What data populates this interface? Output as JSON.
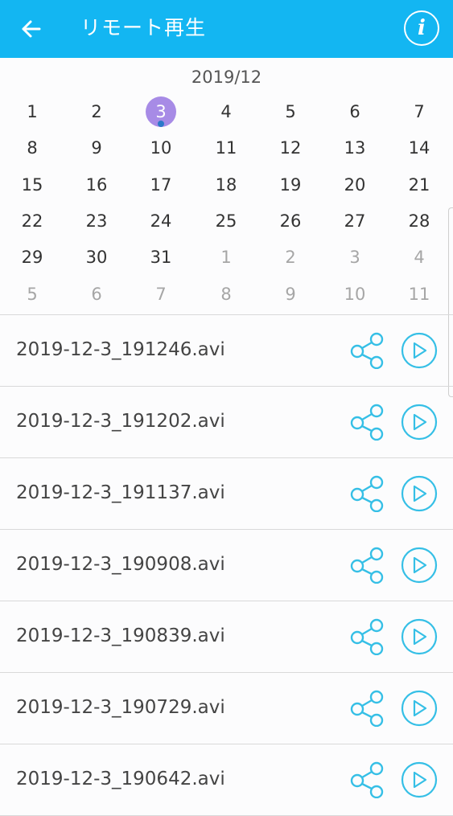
{
  "header": {
    "title": "リモート再生",
    "back_icon": "arrow-left-icon",
    "info_icon": "info-icon",
    "color": "#13b6f2"
  },
  "calendar": {
    "month_label": "2019/12",
    "selected_day": "3",
    "selected_color": "#a78be6",
    "weeks": [
      [
        {
          "d": "1",
          "c": true
        },
        {
          "d": "2",
          "c": true
        },
        {
          "d": "3",
          "c": true,
          "sel": true
        },
        {
          "d": "4",
          "c": true
        },
        {
          "d": "5",
          "c": true
        },
        {
          "d": "6",
          "c": true
        },
        {
          "d": "7",
          "c": true
        }
      ],
      [
        {
          "d": "8",
          "c": true
        },
        {
          "d": "9",
          "c": true
        },
        {
          "d": "10",
          "c": true
        },
        {
          "d": "11",
          "c": true
        },
        {
          "d": "12",
          "c": true
        },
        {
          "d": "13",
          "c": true
        },
        {
          "d": "14",
          "c": true
        }
      ],
      [
        {
          "d": "15",
          "c": true
        },
        {
          "d": "16",
          "c": true
        },
        {
          "d": "17",
          "c": true
        },
        {
          "d": "18",
          "c": true
        },
        {
          "d": "19",
          "c": true
        },
        {
          "d": "20",
          "c": true
        },
        {
          "d": "21",
          "c": true
        }
      ],
      [
        {
          "d": "22",
          "c": true
        },
        {
          "d": "23",
          "c": true
        },
        {
          "d": "24",
          "c": true
        },
        {
          "d": "25",
          "c": true
        },
        {
          "d": "26",
          "c": true
        },
        {
          "d": "27",
          "c": true
        },
        {
          "d": "28",
          "c": true
        }
      ],
      [
        {
          "d": "29",
          "c": true
        },
        {
          "d": "30",
          "c": true
        },
        {
          "d": "31",
          "c": true
        },
        {
          "d": "1",
          "c": false
        },
        {
          "d": "2",
          "c": false
        },
        {
          "d": "3",
          "c": false
        },
        {
          "d": "4",
          "c": false
        }
      ],
      [
        {
          "d": "5",
          "c": false
        },
        {
          "d": "6",
          "c": false
        },
        {
          "d": "7",
          "c": false
        },
        {
          "d": "8",
          "c": false
        },
        {
          "d": "9",
          "c": false
        },
        {
          "d": "10",
          "c": false
        },
        {
          "d": "11",
          "c": false
        }
      ]
    ]
  },
  "files": [
    {
      "name": "2019-12-3_191246.avi"
    },
    {
      "name": "2019-12-3_191202.avi"
    },
    {
      "name": "2019-12-3_191137.avi"
    },
    {
      "name": "2019-12-3_190908.avi"
    },
    {
      "name": "2019-12-3_190839.avi"
    },
    {
      "name": "2019-12-3_190729.avi"
    },
    {
      "name": "2019-12-3_190642.avi"
    }
  ],
  "file_actions": {
    "share_icon": "share-icon",
    "play_icon": "play-icon",
    "accent": "#35bfe6"
  }
}
